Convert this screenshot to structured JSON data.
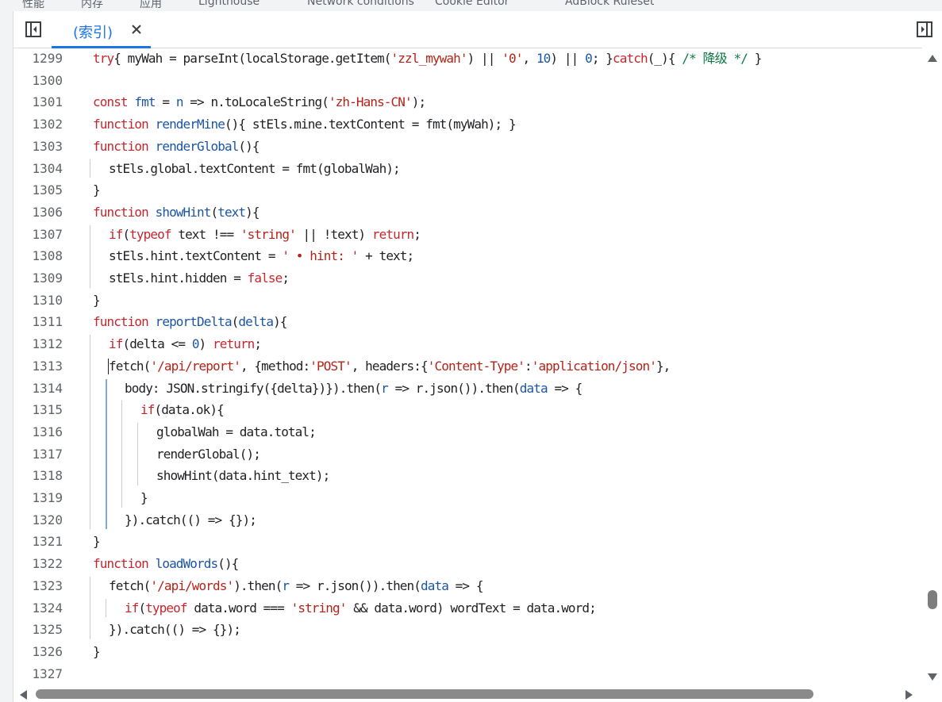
{
  "top_tabs": [
    "性能",
    "内存",
    "应用",
    "Lighthouse",
    "Network conditions",
    "Cookie Editor",
    "AdBlock Ruleset"
  ],
  "editor": {
    "open_file_tab": "(索引)",
    "lines": [
      {
        "no": "1299",
        "indent": 0,
        "html": "<span class=\"k\">try</span>{ myWah = parseInt(localStorage.getItem(<span class=\"s\">'zzl_mywah'</span>) || <span class=\"s\">'0'</span>, <span class=\"n\">10</span>) || <span class=\"n\">0</span>; }<span class=\"k\">catch</span>(_){ <span class=\"c\">/* 降级 */</span> }"
      },
      {
        "no": "1300",
        "indent": 0,
        "html": ""
      },
      {
        "no": "1301",
        "indent": 0,
        "html": "<span class=\"k\">const</span> <span class=\"fn\">fmt</span> = <span class=\"fn\">n</span> => n.toLocaleString(<span class=\"s\">'zh-Hans-CN'</span>);"
      },
      {
        "no": "1302",
        "indent": 0,
        "html": "<span class=\"k\">function</span> <span class=\"fn\">renderMine</span>(){ stEls.mine.textContent = fmt(myWah); }"
      },
      {
        "no": "1303",
        "indent": 0,
        "html": "<span class=\"k\">function</span> <span class=\"fn\">renderGlobal</span>(){"
      },
      {
        "no": "1304",
        "indent": 1,
        "html": "stEls.global.textContent = fmt(globalWah);"
      },
      {
        "no": "1305",
        "indent": 0,
        "html": "}"
      },
      {
        "no": "1306",
        "indent": 0,
        "html": "<span class=\"k\">function</span> <span class=\"fn\">showHint</span>(<span class=\"fn\">text</span>){"
      },
      {
        "no": "1307",
        "indent": 1,
        "html": "<span class=\"k\">if</span>(<span class=\"k\">typeof</span> text !== <span class=\"s\">'string'</span> || !text) <span class=\"k\">return</span>;"
      },
      {
        "no": "1308",
        "indent": 1,
        "html": "stEls.hint.textContent = <span class=\"s\">' • hint: '</span> + text;"
      },
      {
        "no": "1309",
        "indent": 1,
        "html": "stEls.hint.hidden = <span class=\"k\">false</span>;"
      },
      {
        "no": "1310",
        "indent": 0,
        "html": "}"
      },
      {
        "no": "1311",
        "indent": 0,
        "html": "<span class=\"k\">function</span> <span class=\"fn\">reportDelta</span>(<span class=\"fn\">delta</span>){"
      },
      {
        "no": "1312",
        "indent": 1,
        "html": "<span class=\"k\">if</span>(delta <= <span class=\"n\">0</span>) <span class=\"k\">return</span>;"
      },
      {
        "no": "1313",
        "indent": 1,
        "html": "fetch(<span class=\"s\">'/api/report'</span>, {method:<span class=\"s\">'POST'</span>, headers:{<span class=\"s\">'Content-Type'</span>:<span class=\"s\">'application/json'</span>},"
      },
      {
        "no": "1314",
        "indent": 2,
        "html": "body: JSON.stringify({delta})}).then(<span class=\"fn\">r</span> => r.json()).then(<span class=\"fn\">data</span> => {"
      },
      {
        "no": "1315",
        "indent": 3,
        "html": "<span class=\"k\">if</span>(data.ok){"
      },
      {
        "no": "1316",
        "indent": 4,
        "html": "globalWah = data.total;"
      },
      {
        "no": "1317",
        "indent": 4,
        "html": "renderGlobal();"
      },
      {
        "no": "1318",
        "indent": 4,
        "html": "showHint(data.hint_text);"
      },
      {
        "no": "1319",
        "indent": 3,
        "html": "}"
      },
      {
        "no": "1320",
        "indent": 2,
        "html": "}).catch(() => {});"
      },
      {
        "no": "1321",
        "indent": 0,
        "html": "}"
      },
      {
        "no": "1322",
        "indent": 0,
        "html": "<span class=\"k\">function</span> <span class=\"fn\">loadWords</span>(){"
      },
      {
        "no": "1323",
        "indent": 1,
        "html": "fetch(<span class=\"s\">'/api/words'</span>).then(<span class=\"fn\">r</span> => r.json()).then(<span class=\"fn\">data</span> => {"
      },
      {
        "no": "1324",
        "indent": 2,
        "html": "<span class=\"k\">if</span>(<span class=\"k\">typeof</span> data.word === <span class=\"s\">'string'</span> && data.word) wordText = data.word;"
      },
      {
        "no": "1325",
        "indent": 1,
        "html": "}).catch(() => {});"
      },
      {
        "no": "1326",
        "indent": 0,
        "html": "}"
      },
      {
        "no": "1327",
        "indent": 0,
        "html": ""
      }
    ]
  },
  "colors": {
    "accent": "#1a73e8",
    "keyword": "#c6262e",
    "string": "#b42318",
    "function": "#1a55a6",
    "comment": "#0b7a43"
  },
  "icons": {
    "nav_toggle": "panel-left-icon",
    "side_toggle": "panel-right-icon",
    "close": "close-icon"
  }
}
